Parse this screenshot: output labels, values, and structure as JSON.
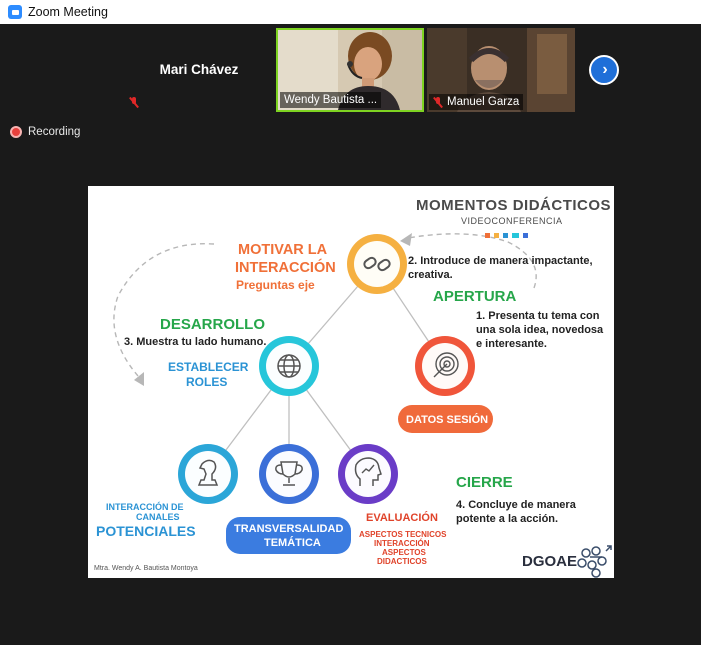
{
  "window": {
    "title": "Zoom Meeting"
  },
  "colors": {
    "zoom_blue": "#2d8cff",
    "active_speaker": "#7ed321",
    "muted_red": "#e02828",
    "recording_red": "#e8413d",
    "slide_orange": "#f07038",
    "slide_green": "#26a64a",
    "slide_blue": "#2b93d4",
    "slide_red": "#e0432a"
  },
  "participants": [
    {
      "name": "Mari Chávez",
      "video": false,
      "muted": true
    },
    {
      "name": "Wendy Bautista ...",
      "video": true,
      "muted": false,
      "active_speaker": true
    },
    {
      "name": "Manuel Garza",
      "video": true,
      "muted": true
    }
  ],
  "gallery": {
    "next_icon": "chevron-right-icon"
  },
  "status": {
    "recording_label": "Recording"
  },
  "slide": {
    "title": "MOMENTOS DIDÁCTICOS",
    "subtitle": "VIDEOCONFERENCIA",
    "motivar_line1": "MOTIVAR LA",
    "motivar_line2": "INTERACCIÓN",
    "motivar_line3": "Preguntas eje",
    "intro_line1": "2. Introduce de manera impactante,",
    "intro_line2": "creativa.",
    "apertura": "APERTURA",
    "presenta_line1": "1. Presenta tu tema con",
    "presenta_line2": "una sola idea, novedosa",
    "presenta_line3": "e interesante.",
    "desarrollo": "DESARROLLO",
    "muestra": "3. Muestra tu lado humano.",
    "establecer_line1": "ESTABLECER",
    "establecer_line2": "ROLES",
    "datos_sesion": "DATOS SESIÓN",
    "cierre": "CIERRE",
    "concluye_line1": "4. Concluye de manera",
    "concluye_line2": "potente a la acción.",
    "interaccion_line1": "INTERACCIÓN DE",
    "interaccion_line2": "CANALES",
    "interaccion_line3": "POTENCIALES",
    "transversalidad_line1": "TRANSVERSALIDAD",
    "transversalidad_line2": "TEMÁTICA",
    "evaluacion": "EVALUACIÓN",
    "aspectos_line1": "ASPECTOS TECNICOS",
    "aspectos_line2": "INTERACCIÓN",
    "aspectos_line3": "ASPECTOS",
    "aspectos_line4": "DIDACTICOS",
    "author": "Mtra. Wendy A. Bautista Montoya",
    "logo_text": "DGOAE",
    "node_icons": [
      "chain-link-icon",
      "globe-icon",
      "target-icon",
      "chess-knight-icon",
      "trophy-icon",
      "chart-head-icon"
    ]
  }
}
